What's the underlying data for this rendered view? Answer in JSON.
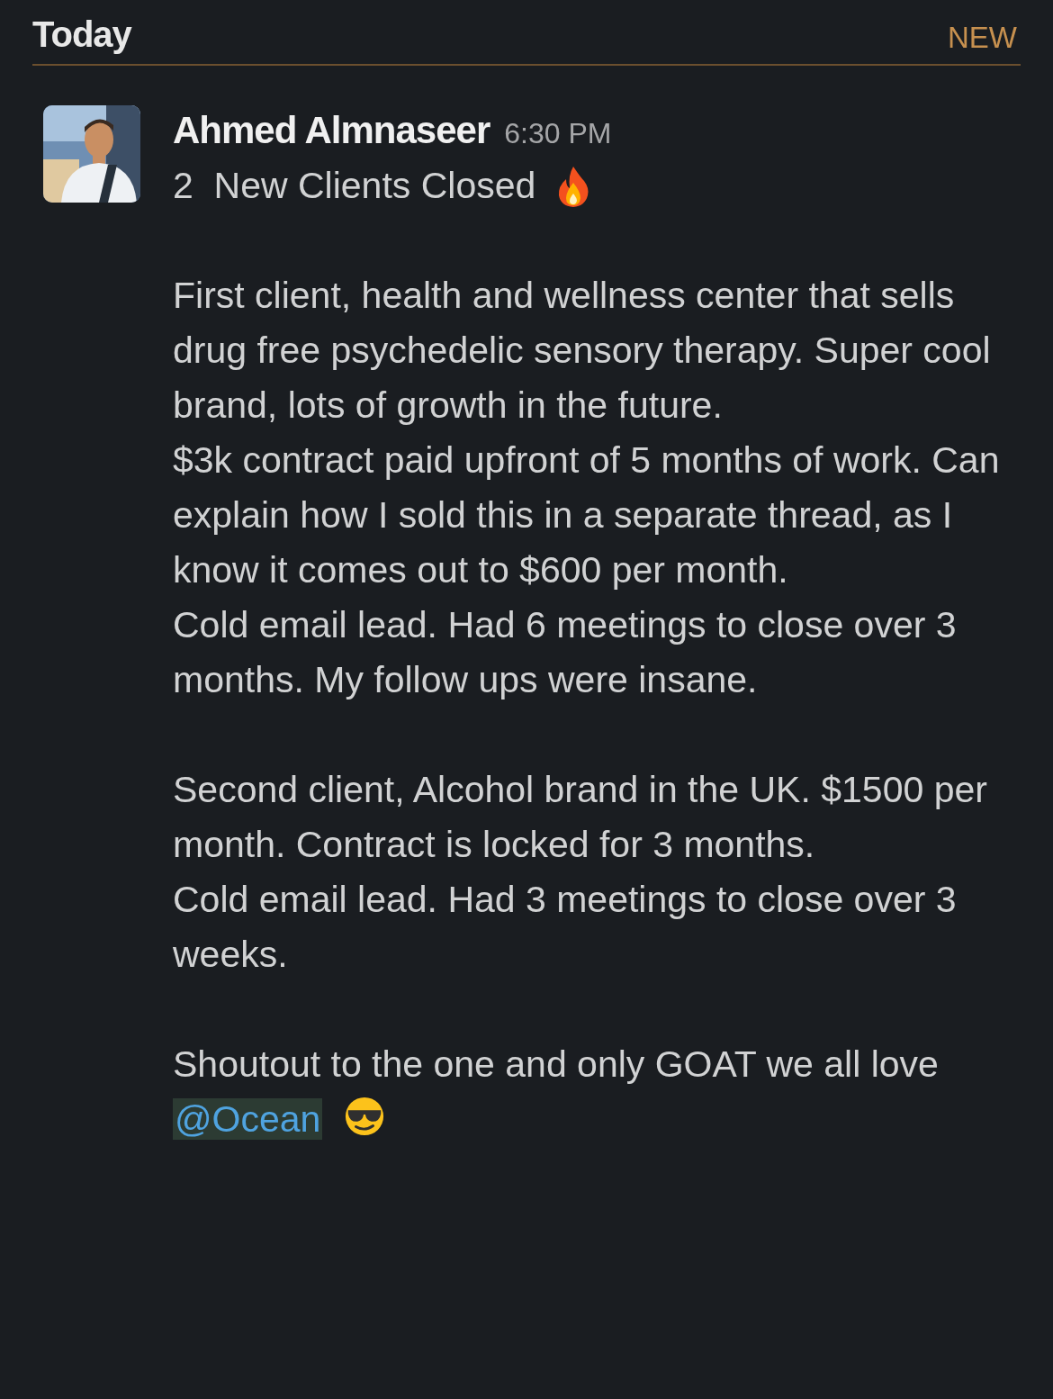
{
  "header": {
    "title": "Today",
    "badge": "NEW"
  },
  "message": {
    "author": "Ahmed Almnaseer",
    "time": "6:30 PM",
    "avatar": {
      "kind": "picture"
    },
    "title": "2  New Clients Closed",
    "blocks": [
      [
        "First client, health and wellness center that sells drug free psychedelic sensory therapy. Super cool brand, lots of growth in the future.",
        "$3k contract paid upfront of 5 months of work. Can explain how I sold this in a separate thread, as I know it comes out to $600 per month.",
        "Cold email lead. Had 6 meetings to close over 3 months. My follow ups were insane."
      ],
      [
        "Second client, Alcohol brand in the UK. $1500 per month. Contract is locked for 3 months.",
        "Cold email lead. Had 3 meetings to close over 3 weeks."
      ]
    ],
    "shoutout": {
      "text": "Shoutout to the one and only GOAT we all love",
      "mention": "@Ocean"
    }
  }
}
